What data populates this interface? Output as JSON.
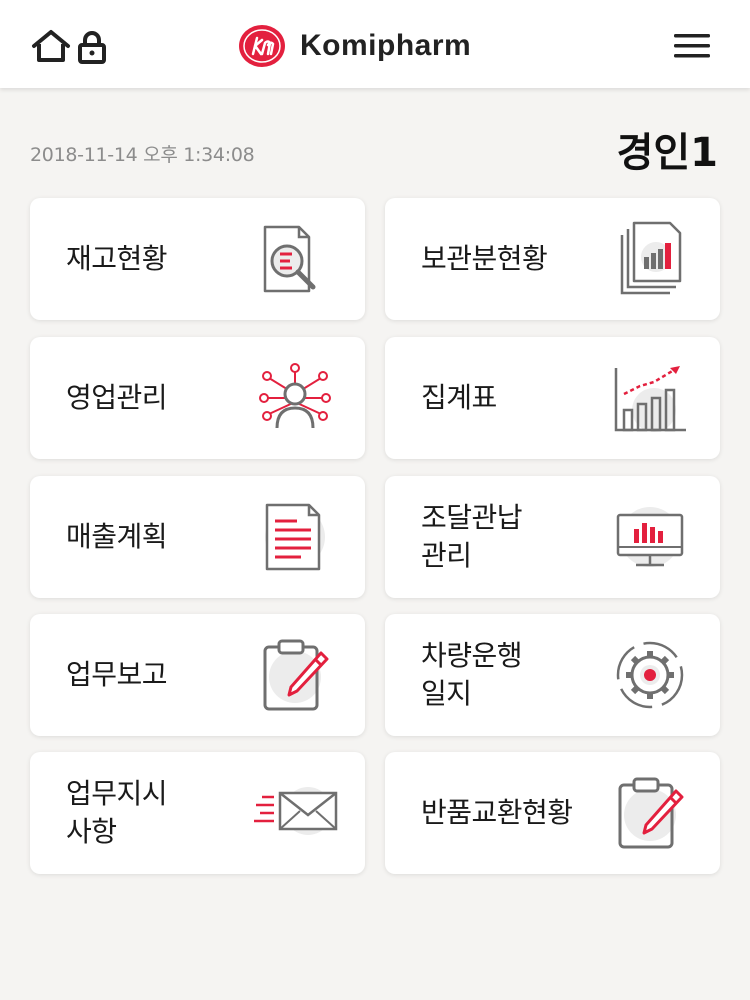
{
  "header": {
    "logo_text": "Komipharm",
    "icons": [
      "home-icon",
      "lock-icon",
      "menu-icon"
    ]
  },
  "status": {
    "timestamp": "2018-11-14 오후 1:34:08",
    "user_name": "경인1"
  },
  "colors": {
    "accent": "#e3203e",
    "icon_gray": "#6f6f6f",
    "background": "#f5f4f2",
    "card": "#ffffff"
  },
  "menu": {
    "items": [
      {
        "label": "재고현황",
        "icon": "inventory-search-icon"
      },
      {
        "label": "보관분현황",
        "icon": "storage-report-icon"
      },
      {
        "label": "영업관리",
        "icon": "sales-network-icon"
      },
      {
        "label": "집계표",
        "icon": "growth-chart-icon"
      },
      {
        "label": "매출계획",
        "icon": "sales-plan-document-icon"
      },
      {
        "label": "조달관납\n관리",
        "icon": "procurement-monitor-icon"
      },
      {
        "label": "업무보고",
        "icon": "clipboard-pencil-icon"
      },
      {
        "label": "차량운행\n일지",
        "icon": "vehicle-gear-icon"
      },
      {
        "label": "업무지시\n사항",
        "icon": "fast-mail-icon"
      },
      {
        "label": "반품교환현황",
        "icon": "return-clipboard-icon"
      }
    ]
  }
}
